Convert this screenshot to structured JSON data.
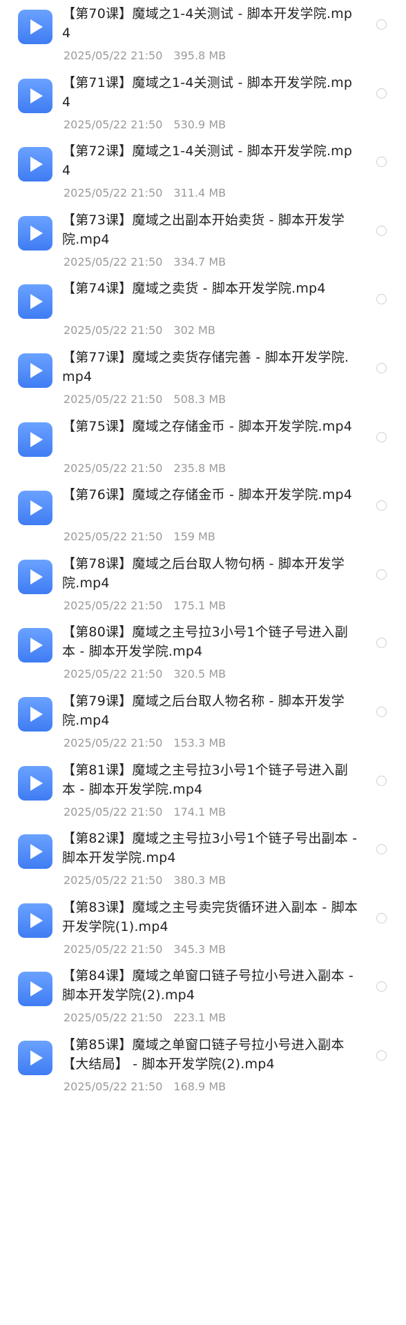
{
  "files": [
    {
      "name": "【第70课】魔域之1-4关测试 - 脚本开发学院.mp4",
      "date": "2025/05/22 21:50",
      "size": "395.8 MB",
      "icon": "video-play-icon"
    },
    {
      "name": "【第71课】魔域之1-4关测试 - 脚本开发学院.mp4",
      "date": "2025/05/22 21:50",
      "size": "530.9 MB",
      "icon": "video-play-icon"
    },
    {
      "name": "【第72课】魔域之1-4关测试 - 脚本开发学院.mp4",
      "date": "2025/05/22 21:50",
      "size": "311.4 MB",
      "icon": "video-play-icon"
    },
    {
      "name": "【第73课】魔域之出副本开始卖货 - 脚本开发学院.mp4",
      "date": "2025/05/22 21:50",
      "size": "334.7 MB",
      "icon": "video-play-icon"
    },
    {
      "name": "【第74课】魔域之卖货 - 脚本开发学院.mp4",
      "date": "2025/05/22 21:50",
      "size": "302 MB",
      "icon": "video-play-icon"
    },
    {
      "name": "【第77课】魔域之卖货存储完善 - 脚本开发学院.mp4",
      "date": "2025/05/22 21:50",
      "size": "508.3 MB",
      "icon": "video-play-icon"
    },
    {
      "name": "【第75课】魔域之存储金币 - 脚本开发学院.mp4",
      "date": "2025/05/22 21:50",
      "size": "235.8 MB",
      "icon": "video-play-icon"
    },
    {
      "name": "【第76课】魔域之存储金币 - 脚本开发学院.mp4",
      "date": "2025/05/22 21:50",
      "size": "159 MB",
      "icon": "video-play-icon"
    },
    {
      "name": "【第78课】魔域之后台取人物句柄 - 脚本开发学院.mp4",
      "date": "2025/05/22 21:50",
      "size": "175.1 MB",
      "icon": "video-play-icon"
    },
    {
      "name": "【第80课】魔域之主号拉3小号1个链子号进入副本 - 脚本开发学院.mp4",
      "date": "2025/05/22 21:50",
      "size": "320.5 MB",
      "icon": "video-play-icon"
    },
    {
      "name": "【第79课】魔域之后台取人物名称 - 脚本开发学院.mp4",
      "date": "2025/05/22 21:50",
      "size": "153.3 MB",
      "icon": "video-play-icon"
    },
    {
      "name": "【第81课】魔域之主号拉3小号1个链子号进入副本 - 脚本开发学院.mp4",
      "date": "2025/05/22 21:50",
      "size": "174.1 MB",
      "icon": "video-play-icon"
    },
    {
      "name": "【第82课】魔域之主号拉3小号1个链子号出副本 - 脚本开发学院.mp4",
      "date": "2025/05/22 21:50",
      "size": "380.3 MB",
      "icon": "video-play-icon"
    },
    {
      "name": "【第83课】魔域之主号卖完货循环进入副本 - 脚本开发学院(1).mp4",
      "date": "2025/05/22 21:50",
      "size": "345.3 MB",
      "icon": "video-play-icon"
    },
    {
      "name": "【第84课】魔域之单窗口链子号拉小号进入副本 - 脚本开发学院(2).mp4",
      "date": "2025/05/22 21:50",
      "size": "223.1 MB",
      "icon": "video-play-icon"
    },
    {
      "name": "【第85课】魔域之单窗口链子号拉小号进入副本【大结局】 - 脚本开发学院(2).mp4",
      "date": "2025/05/22 21:50",
      "size": "168.9 MB",
      "icon": "video-play-icon"
    }
  ]
}
